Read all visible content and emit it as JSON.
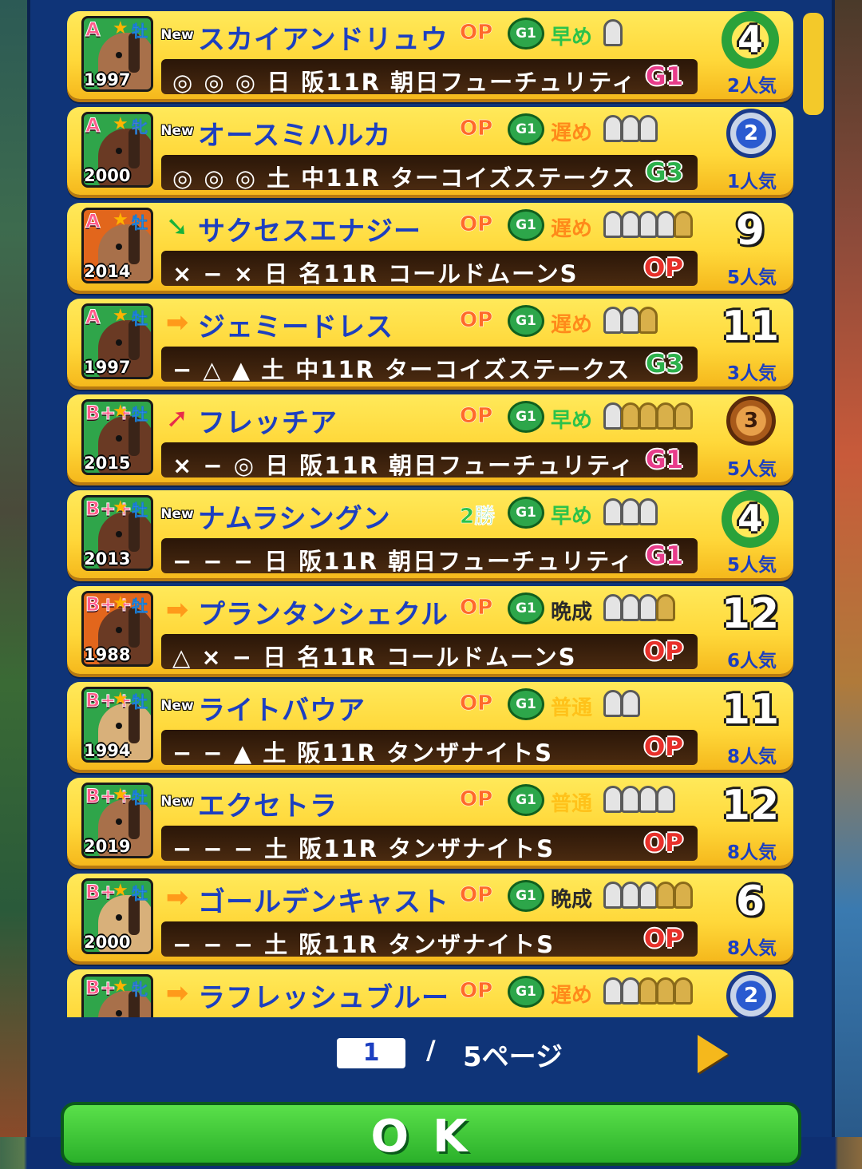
{
  "horses": [
    {
      "rank": "A",
      "sex": "牡",
      "sex_type": "m",
      "year": "1997",
      "badge": "New",
      "badge_type": "new",
      "name": "スカイアンドリュウ",
      "class": "OP",
      "class_type": "op",
      "g1": "G1",
      "style": "早め",
      "style_type": "early",
      "shoes": [
        0
      ],
      "race": "◎ ◎ ◎  日  阪11R  朝日フューチュリティ",
      "grade": "G1",
      "grade_type": "g1c",
      "place": "4",
      "place_type": "wreath",
      "popularity": "2人気",
      "portrait": "green",
      "coat": "c1"
    },
    {
      "rank": "A",
      "sex": "牝",
      "sex_type": "f",
      "year": "2000",
      "badge": "New",
      "badge_type": "new",
      "name": "オースミハルカ",
      "class": "OP",
      "class_type": "op",
      "g1": "G1",
      "style": "遅め",
      "style_type": "late",
      "shoes": [
        0,
        0,
        0
      ],
      "race": "◎ ◎ ◎  土  中11R  ターコイズステークス",
      "grade": "G3",
      "grade_type": "g3c",
      "place": "2",
      "place_type": "silver",
      "popularity": "1人気",
      "portrait": "green",
      "coat": "c3"
    },
    {
      "rank": "A",
      "sex": "牡",
      "sex_type": "m",
      "year": "2014",
      "badge": "➘",
      "badge_type": "down",
      "name": "サクセスエナジー",
      "class": "OP",
      "class_type": "op",
      "g1": "G1",
      "style": "遅め",
      "style_type": "late",
      "shoes": [
        0,
        0,
        0,
        0,
        1
      ],
      "race": "×  −  ×  日  名11R  コールドムーンS",
      "grade": "OP",
      "grade_type": "opc",
      "place": "9",
      "place_type": "plain",
      "popularity": "5人気",
      "portrait": "orange",
      "coat": "c1"
    },
    {
      "rank": "A",
      "sex": "牡",
      "sex_type": "m",
      "year": "1997",
      "badge": "➡",
      "badge_type": "right",
      "name": "ジェミードレス",
      "class": "OP",
      "class_type": "op",
      "g1": "G1",
      "style": "遅め",
      "style_type": "late",
      "shoes": [
        0,
        0,
        1
      ],
      "race": "−  △  ▲  土  中11R  ターコイズステークス",
      "grade": "G3",
      "grade_type": "g3c",
      "place": "11",
      "place_type": "plain",
      "popularity": "3人気",
      "portrait": "green",
      "coat": "c3"
    },
    {
      "rank": "B++",
      "sex": "牡",
      "sex_type": "m",
      "year": "2015",
      "badge": "➚",
      "badge_type": "up",
      "name": "フレッチア",
      "class": "OP",
      "class_type": "op",
      "g1": "G1",
      "style": "早め",
      "style_type": "early",
      "shoes": [
        0,
        1,
        1,
        1,
        1
      ],
      "race": "×  −  ◎  日  阪11R  朝日フューチュリティ",
      "grade": "G1",
      "grade_type": "g1c",
      "place": "3",
      "place_type": "bronze",
      "popularity": "5人気",
      "portrait": "green",
      "coat": "c3"
    },
    {
      "rank": "B++",
      "sex": "牡",
      "sex_type": "m",
      "year": "2013",
      "badge": "New",
      "badge_type": "new",
      "name": "ナムラシングン",
      "class": "2勝",
      "class_type": "win",
      "g1": "G1",
      "style": "早め",
      "style_type": "early",
      "shoes": [
        0,
        0,
        0
      ],
      "race": "−  −  −  日  阪11R  朝日フューチュリティ",
      "grade": "G1",
      "grade_type": "g1c",
      "place": "4",
      "place_type": "wreath",
      "popularity": "5人気",
      "portrait": "green",
      "coat": "c3"
    },
    {
      "rank": "B++",
      "sex": "牡",
      "sex_type": "m",
      "year": "1988",
      "badge": "➡",
      "badge_type": "right",
      "name": "プランタンシェクル",
      "class": "OP",
      "class_type": "op",
      "g1": "G1",
      "style": "晩成",
      "style_type": "slow",
      "shoes": [
        0,
        0,
        0,
        1
      ],
      "race": "△  ×  −  日  名11R  コールドムーンS",
      "grade": "OP",
      "grade_type": "opc",
      "place": "12",
      "place_type": "plain",
      "popularity": "6人気",
      "portrait": "orange",
      "coat": "c3"
    },
    {
      "rank": "B++",
      "sex": "牡",
      "sex_type": "m",
      "year": "1994",
      "badge": "New",
      "badge_type": "new",
      "name": "ライトバウア",
      "class": "OP",
      "class_type": "op",
      "g1": "G1",
      "style": "普通",
      "style_type": "norm",
      "shoes": [
        0,
        0
      ],
      "race": "−  −  ▲  土  阪11R  タンザナイトS",
      "grade": "OP",
      "grade_type": "opc",
      "place": "11",
      "place_type": "plain",
      "popularity": "8人気",
      "portrait": "green",
      "coat": "c2"
    },
    {
      "rank": "B++",
      "sex": "牡",
      "sex_type": "m",
      "year": "2019",
      "badge": "New",
      "badge_type": "new",
      "name": "エクセトラ",
      "class": "OP",
      "class_type": "op",
      "g1": "G1",
      "style": "普通",
      "style_type": "norm",
      "shoes": [
        0,
        0,
        0,
        0
      ],
      "race": "−  −  −  土  阪11R  タンザナイトS",
      "grade": "OP",
      "grade_type": "opc",
      "place": "12",
      "place_type": "plain",
      "popularity": "8人気",
      "portrait": "green",
      "coat": "c1"
    },
    {
      "rank": "B+",
      "sex": "牡",
      "sex_type": "m",
      "year": "2000",
      "badge": "➡",
      "badge_type": "right",
      "name": "ゴールデンキャスト",
      "class": "OP",
      "class_type": "op",
      "g1": "G1",
      "style": "晩成",
      "style_type": "slow",
      "shoes": [
        0,
        0,
        0,
        1,
        1
      ],
      "race": "−  −  −  土  阪11R  タンザナイトS",
      "grade": "OP",
      "grade_type": "opc",
      "place": "6",
      "place_type": "plain",
      "popularity": "8人気",
      "portrait": "green",
      "coat": "c2"
    },
    {
      "rank": "B+",
      "sex": "牝",
      "sex_type": "f",
      "year": "",
      "badge": "➡",
      "badge_type": "right",
      "name": "ラフレッシュブルー",
      "class": "OP",
      "class_type": "op",
      "g1": "G1",
      "style": "遅め",
      "style_type": "late",
      "shoes": [
        0,
        0,
        1,
        1,
        1
      ],
      "race": "",
      "grade": "",
      "grade_type": "opc",
      "place": "2",
      "place_type": "silver",
      "popularity": "",
      "portrait": "green",
      "coat": "c1"
    }
  ],
  "pager": {
    "current": "1",
    "slash": "/",
    "total": "5ページ"
  },
  "ok_label": "OK"
}
